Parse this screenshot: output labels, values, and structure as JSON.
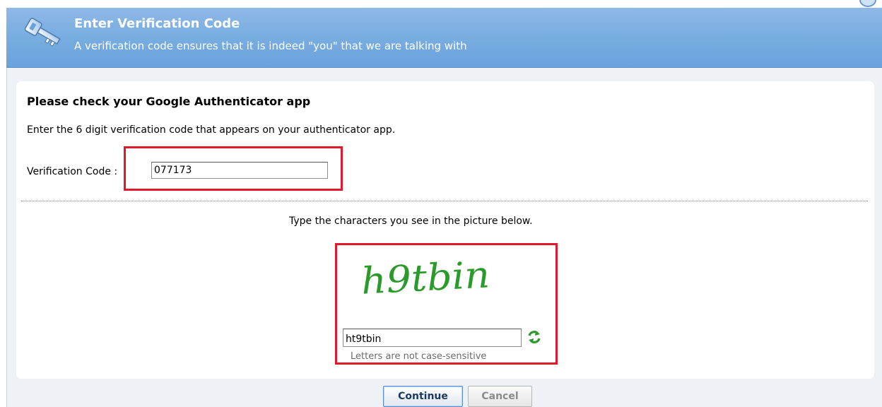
{
  "header": {
    "title": "Enter Verification Code",
    "subtitle": "A verification code ensures that it is indeed \"you\" that we are talking with",
    "icon": "key-icon",
    "bg_color": "#7aaee2"
  },
  "form": {
    "heading": "Please check your Google Authenticator app",
    "instructions": "Enter the 6 digit verification code that appears on your authenticator app.",
    "verification_label": "Verification Code :",
    "verification_value": "077173"
  },
  "captcha": {
    "prompt": "Type the characters you see in the picture below.",
    "image_text": "h9tbin",
    "image_color": "#2a9a2a",
    "input_value": "ht9tbin",
    "note": "Letters are not case-sensitive",
    "refresh_icon": "refresh-icon"
  },
  "buttons": {
    "continue_label": "Continue",
    "cancel_label": "Cancel"
  },
  "highlight_color": "#e01a2a"
}
